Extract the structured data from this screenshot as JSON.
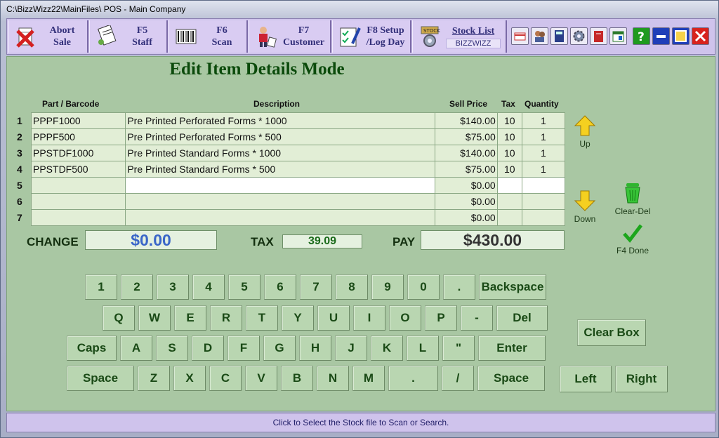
{
  "window": {
    "title": "C:\\BizzWizz22\\MainFiles\\ POS - Main Company"
  },
  "toolbar": {
    "buttons": [
      {
        "line1": "Abort",
        "line2": "Sale"
      },
      {
        "line1": "F5",
        "line2": "Staff"
      },
      {
        "line1": "F6",
        "line2": "Scan"
      },
      {
        "line1": "F7",
        "line2": "Customer"
      },
      {
        "line1": "F8 Setup",
        "line2": "/Log Day"
      },
      {
        "line1": "Stock List",
        "line2": "BIZZWIZZ"
      }
    ],
    "small_icons": [
      "card-icon",
      "people-icon",
      "calculator-icon",
      "gear-icon",
      "book-icon",
      "calendar-icon"
    ],
    "window_controls": [
      "help-icon",
      "minimize-icon",
      "maximize-icon",
      "close-icon"
    ]
  },
  "mode_title": "Edit Item Details Mode",
  "grid": {
    "headers": [
      "Part / Barcode",
      "Description",
      "Sell Price",
      "Tax",
      "Quantity"
    ],
    "rows": [
      {
        "n": "1",
        "part": "PPPF1000",
        "desc": "Pre Printed Perforated Forms  * 1000",
        "price": "$140.00",
        "tax": "10",
        "qty": "1"
      },
      {
        "n": "2",
        "part": "PPPF500",
        "desc": "Pre Printed Perforated Forms * 500",
        "price": "$75.00",
        "tax": "10",
        "qty": "1"
      },
      {
        "n": "3",
        "part": "PPSTDF1000",
        "desc": "Pre Printed Standard Forms * 1000",
        "price": "$140.00",
        "tax": "10",
        "qty": "1"
      },
      {
        "n": "4",
        "part": "PPSTDF500",
        "desc": "Pre Printed Standard Forms * 500",
        "price": "$75.00",
        "tax": "10",
        "qty": "1"
      },
      {
        "n": "5",
        "part": "",
        "desc": "",
        "price": "$0.00",
        "tax": "",
        "qty": ""
      },
      {
        "n": "6",
        "part": "",
        "desc": "",
        "price": "$0.00",
        "tax": "",
        "qty": ""
      },
      {
        "n": "7",
        "part": "",
        "desc": "",
        "price": "$0.00",
        "tax": "",
        "qty": ""
      }
    ]
  },
  "side": {
    "up": "Up",
    "down": "Down",
    "clear_del": "Clear-Del",
    "done": "F4 Done"
  },
  "totals": {
    "change_label": "CHANGE",
    "change": "$0.00",
    "tax_label": "TAX",
    "tax": "39.09",
    "pay_label": "PAY",
    "pay": "$430.00"
  },
  "keyboard": {
    "row1": [
      "1",
      "2",
      "3",
      "4",
      "5",
      "6",
      "7",
      "8",
      "9",
      "0",
      ".",
      "Backspace"
    ],
    "row2": [
      "Q",
      "W",
      "E",
      "R",
      "T",
      "Y",
      "U",
      "I",
      "O",
      "P",
      "-",
      "Del"
    ],
    "row3": [
      "Caps",
      "A",
      "S",
      "D",
      "F",
      "G",
      "H",
      "J",
      "K",
      "L",
      "\"",
      "Enter"
    ],
    "row4": [
      "Space",
      "Z",
      "X",
      "C",
      "V",
      "B",
      "N",
      "M",
      ".",
      "/",
      "Space"
    ],
    "clear_box": "Clear Box",
    "left": "Left",
    "right": "Right"
  },
  "status": "Click to Select the Stock file to Scan or Search."
}
